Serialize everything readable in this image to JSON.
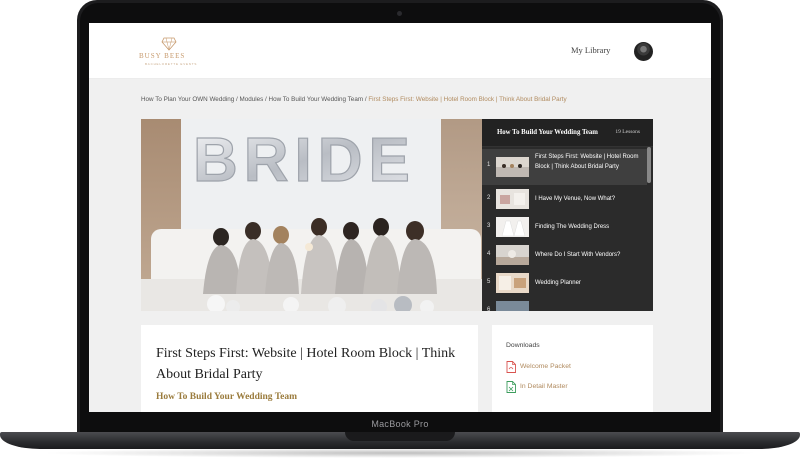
{
  "device": {
    "label": "MacBook Pro"
  },
  "header": {
    "logo_text": "BUSY BEES",
    "logo_subtext": "BACHELORETTE EVENTS",
    "nav_library": "My Library"
  },
  "breadcrumb": {
    "items": [
      "How To Plan Your OWN Wedding",
      "Modules",
      "How To Build Your Wedding Team"
    ],
    "current": "First Steps First: Website | Hotel Room Block | Think About Bridal Party"
  },
  "hero": {
    "balloon_letters": "BRIDE"
  },
  "playlist": {
    "title": "How To Build Your Wedding Team",
    "count": "19 Lessons",
    "lessons": [
      {
        "num": "1",
        "title": "First Steps First: Website | Hotel Room Block | Think About Bridal Party"
      },
      {
        "num": "2",
        "title": "I Have My Venue, Now What?"
      },
      {
        "num": "3",
        "title": "Finding The Wedding Dress"
      },
      {
        "num": "4",
        "title": "Where Do I Start With Vendors?"
      },
      {
        "num": "5",
        "title": "Wedding Planner"
      },
      {
        "num": "6",
        "title": ""
      }
    ]
  },
  "lesson": {
    "title": "First Steps First: Website | Hotel Room Block | Think About Bridal Party",
    "module": "How To Build Your Wedding Team"
  },
  "downloads": {
    "title": "Downloads",
    "items": [
      {
        "label": "Welcome Packet",
        "icon": "pdf-file-icon",
        "color": "#d9534f"
      },
      {
        "label": "In Detail Master",
        "icon": "spreadsheet-file-icon",
        "color": "#3c9d5d"
      }
    ]
  },
  "colors": {
    "accent": "#b08a5e",
    "module": "#9a7b3c",
    "playlist_bg": "#2b2b2b"
  }
}
